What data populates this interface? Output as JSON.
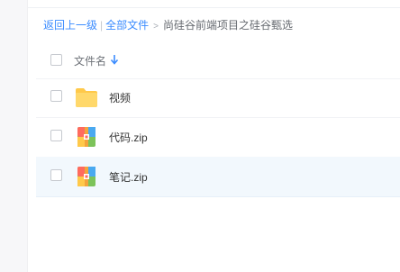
{
  "breadcrumb": {
    "back": "返回上一级",
    "separator": "|",
    "all_files": "全部文件",
    "arrow": ">",
    "current": "尚硅谷前端项目之硅谷甄选"
  },
  "list": {
    "column_name": "文件名",
    "sort_icon": "arrow-down-icon",
    "files": [
      {
        "name": "视频",
        "icon": "folder-icon",
        "selected": false
      },
      {
        "name": "代码.zip",
        "icon": "zip-file-icon",
        "selected": false
      },
      {
        "name": "笔记.zip",
        "icon": "zip-file-icon",
        "selected": false,
        "hovered": true
      }
    ]
  },
  "colors": {
    "accent": "#3b8cff",
    "row_hover": "#f2f8fd",
    "folder": "#ffd35e"
  }
}
